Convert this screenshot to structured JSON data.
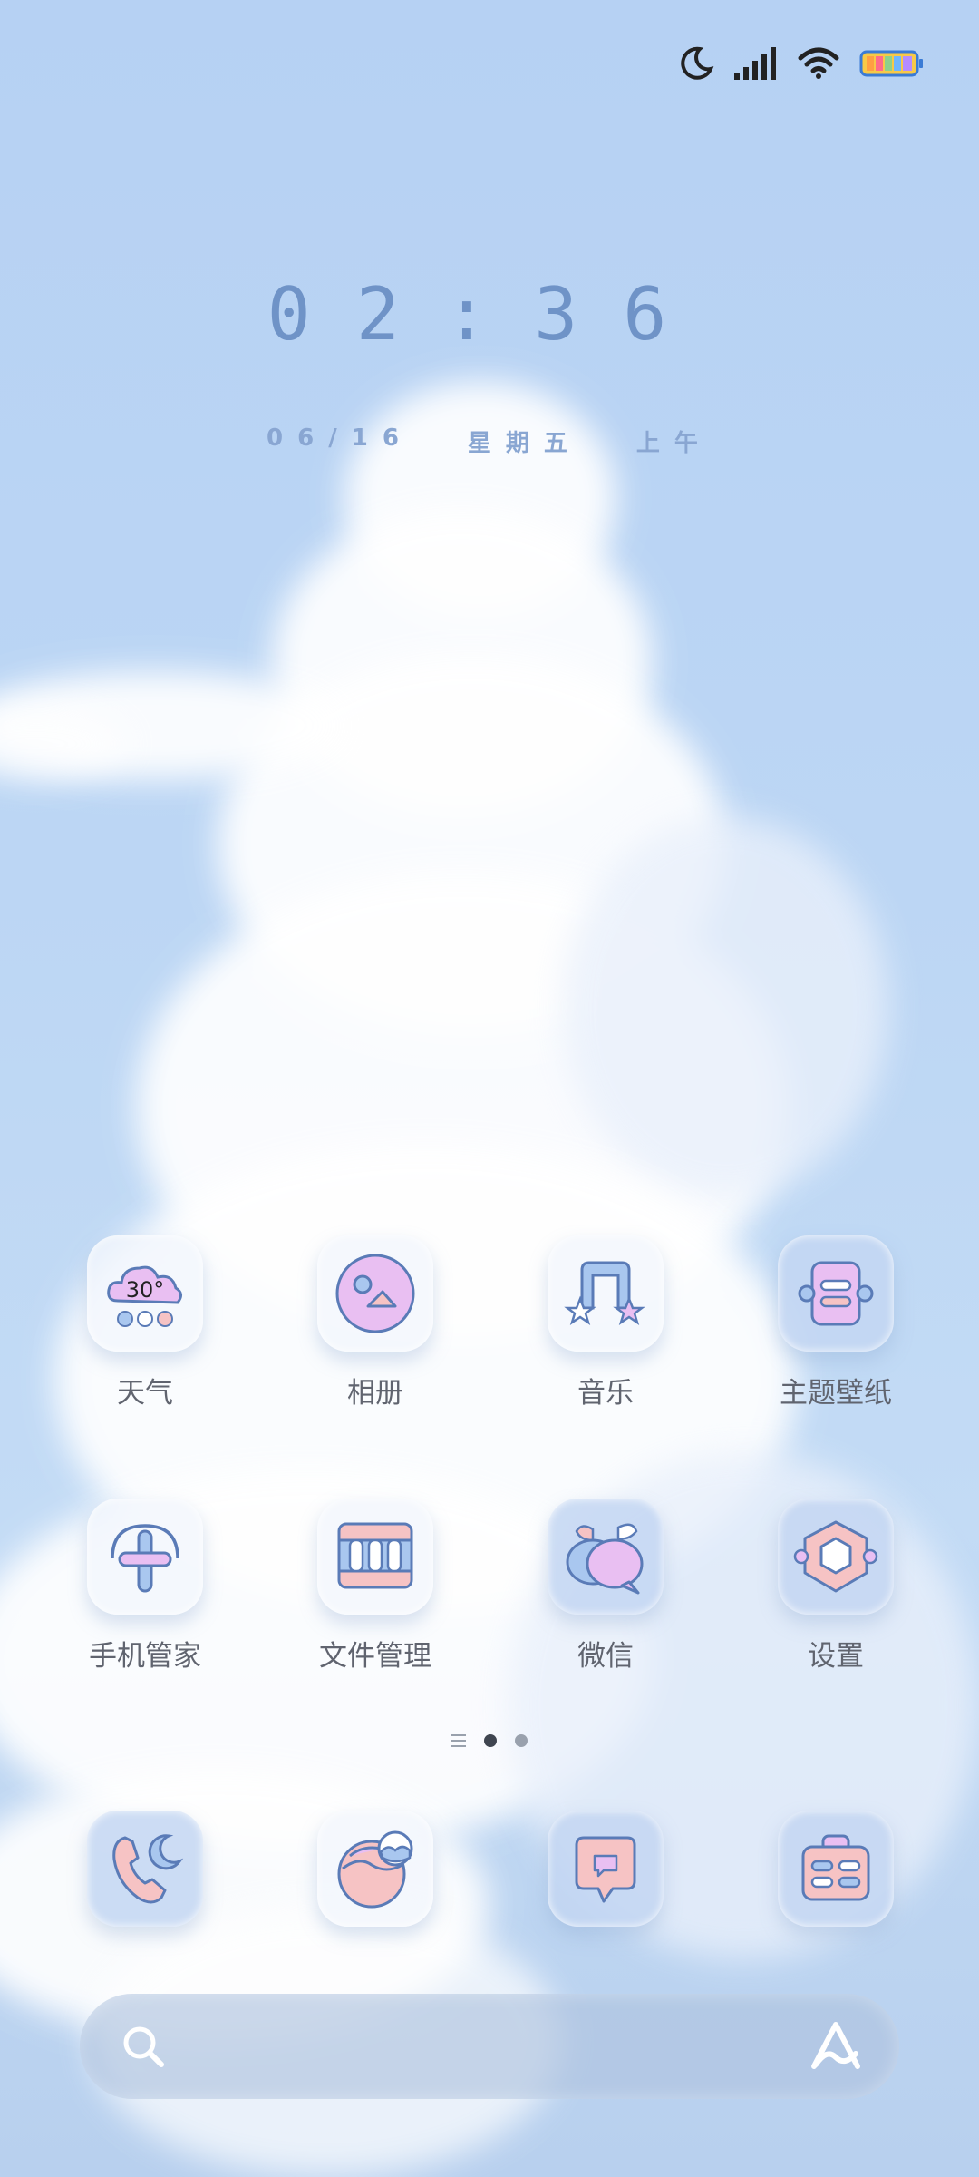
{
  "status_bar": {
    "icons": [
      "moon-icon",
      "signal-icon",
      "wifi-icon",
      "battery-icon"
    ]
  },
  "clock": {
    "time": "02:36",
    "date": "06/16",
    "weekday": "星期五",
    "period": "上午"
  },
  "apps": [
    {
      "label": "天气",
      "icon": "weather-icon",
      "temp": "30°"
    },
    {
      "label": "相册",
      "icon": "gallery-icon"
    },
    {
      "label": "音乐",
      "icon": "music-icon"
    },
    {
      "label": "主题壁纸",
      "icon": "themes-icon"
    },
    {
      "label": "手机管家",
      "icon": "security-icon"
    },
    {
      "label": "文件管理",
      "icon": "file-manager-icon"
    },
    {
      "label": "微信",
      "icon": "wechat-icon"
    },
    {
      "label": "设置",
      "icon": "settings-icon"
    }
  ],
  "page_indicator": {
    "pages": 2,
    "current": 1
  },
  "dock": [
    {
      "icon": "phone-icon"
    },
    {
      "icon": "browser-icon"
    },
    {
      "icon": "messages-icon"
    },
    {
      "icon": "toolbox-icon"
    }
  ],
  "search_bar": {
    "icons": [
      "search-icon",
      "assistant-icon"
    ]
  },
  "colors": {
    "pink": "#f6c3c4",
    "lilac": "#e9bff2",
    "blue": "#a9c7ef",
    "outline": "#5a7bb7"
  }
}
